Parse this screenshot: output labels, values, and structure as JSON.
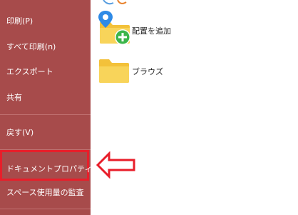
{
  "sidebar": {
    "items": [
      {
        "label": "印刷(P)"
      },
      {
        "label": "すべて印刷(n)"
      },
      {
        "label": "エクスポート"
      },
      {
        "label": "共有"
      },
      {
        "label": "戻す(V)"
      },
      {
        "label": "ドキュメントプロパティ(D)"
      },
      {
        "label": "スペース使用量の監査"
      }
    ]
  },
  "content": {
    "add_location_label": "配置を追加",
    "browse_label": "ブラウズ"
  },
  "colors": {
    "sidebar_bg": "#a74b4b",
    "highlight_border": "#e81e2a",
    "folder_yellow": "#f3c13a",
    "plus_green": "#3bb54a",
    "pin_blue": "#2e8ae6"
  },
  "icons": {
    "add_location": "folder-plus-icon",
    "browse": "folder-icon",
    "pointer": "arrow-left-icon"
  }
}
